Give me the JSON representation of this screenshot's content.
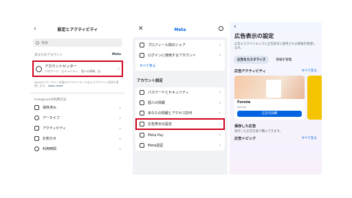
{
  "panel1": {
    "title": "設定とアクティビティ",
    "search_placeholder": "検索",
    "account_section": "あなたのアカウント",
    "meta_label": "Meta",
    "account_center": {
      "title": "アカウントセンター",
      "subtitle": "パスワード、セキュリティ、個人の情報、広"
    },
    "note": "Metaのテクノロジー全般のエクスペリエンスおよびアカウント設定を管理します。",
    "learn_more": "Learn more",
    "usage_section": "Instagramの利用方法",
    "items": [
      {
        "label": "保存済み"
      },
      {
        "label": "アーカイブ"
      },
      {
        "label": "アクティビティ"
      },
      {
        "label": "お知らせ"
      },
      {
        "label": "利用時間"
      }
    ]
  },
  "panel2": {
    "brand": "Meta",
    "top_items": [
      {
        "label": "プロフィール間のシェア"
      },
      {
        "label": "ログインに使用するアカウント"
      }
    ],
    "see_all": "すべて見る",
    "section": "アカウント設定",
    "items": [
      {
        "label": "パスワードとセキュリティ"
      },
      {
        "label": "個人の情報"
      },
      {
        "label": "あなたの情報とアクセス許可"
      },
      {
        "label": "広告表示の設定"
      },
      {
        "label": "Meta Pay"
      },
      {
        "label": "Meta認証"
      }
    ]
  },
  "panel3": {
    "title": "広告表示の設定",
    "description": "広告エクスペリエンスと広告表示に使用される情報を管理します。",
    "tabs": [
      {
        "label": "広告をカスタマイズ",
        "active": true
      },
      {
        "label": "情報を管理",
        "active": false
      }
    ],
    "activity_title": "広告アクティビティ",
    "see_all": "すべて見る",
    "ad_card": {
      "name": "Formie",
      "source": "Formie",
      "button": "広告の詳細"
    },
    "saved_title": "保存した広告",
    "saved_desc": "保存した広告を後で購入できます。",
    "topics_title": "広告トピック",
    "topics_see_all": "すべて見る"
  },
  "colors": {
    "highlight": "#d0021b",
    "link": "#0064e0"
  }
}
